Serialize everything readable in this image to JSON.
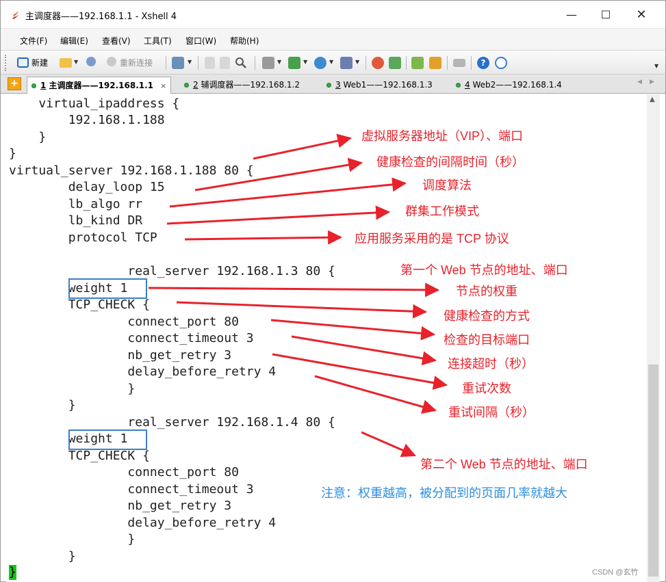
{
  "window": {
    "title": "主调度器——192.168.1.1 - Xshell 4",
    "minimize": "—",
    "maximize": "☐",
    "close": "✕"
  },
  "menu": [
    "文件(F)",
    "编辑(E)",
    "查看(V)",
    "工具(T)",
    "窗口(W)",
    "帮助(H)"
  ],
  "toolbar": {
    "new_label": "新建",
    "reconnect_label": "重新连接"
  },
  "tabs": [
    {
      "num": "1",
      "label": "主调度器——192.168.1.1",
      "active": true
    },
    {
      "num": "2",
      "label": "辅调度器——192.168.1.2",
      "active": false
    },
    {
      "num": "3",
      "label": "Web1——192.168.1.3",
      "active": false
    },
    {
      "num": "4",
      "label": "Web2——192.168.1.4",
      "active": false
    }
  ],
  "terminal": {
    "lines": [
      "    virtual_ipaddress {",
      "        192.168.1.188",
      "    }",
      "}",
      "virtual_server 192.168.1.188 80 {",
      "        delay_loop 15",
      "        lb_algo rr",
      "        lb_kind DR",
      "        protocol TCP",
      "",
      "                real_server 192.168.1.3 80 {",
      "        weight 1",
      "        TCP_CHECK {",
      "                connect_port 80",
      "                connect_timeout 3",
      "                nb_get_retry 3",
      "                delay_before_retry 4",
      "                }",
      "        }",
      "                real_server 192.168.1.4 80 {",
      "        weight 1",
      "        TCP_CHECK {",
      "                connect_port 80",
      "                connect_timeout 3",
      "                nb_get_retry 3",
      "                delay_before_retry 4",
      "                }",
      "        }"
    ],
    "cursor_char": "}"
  },
  "annotations": {
    "vip": "虚拟服务器地址（VIP）、端口",
    "delay_loop": "健康检查的间隔时间（秒）",
    "lb_algo": "调度算法",
    "lb_kind": "群集工作模式",
    "protocol": "应用服务采用的是 TCP 协议",
    "real_server_1": "第一个 Web 节点的地址、端口",
    "weight": "节点的权重",
    "tcp_check": "健康检查的方式",
    "connect_port": "检查的目标端口",
    "connect_timeout": "连接超时（秒）",
    "nb_get_retry": "重试次数",
    "delay_before_retry": "重试间隔（秒）",
    "real_server_2": "第二个 Web 节点的地址、端口",
    "note": "注意：权重越高，被分配到的页面几率就越大"
  },
  "watermark": "CSDN @玄竹",
  "colors": {
    "annotation_red": "#e8222b",
    "note_blue": "#2d8fe0",
    "highlight_box": "#3b7fc4",
    "cursor_green": "#19c719"
  }
}
